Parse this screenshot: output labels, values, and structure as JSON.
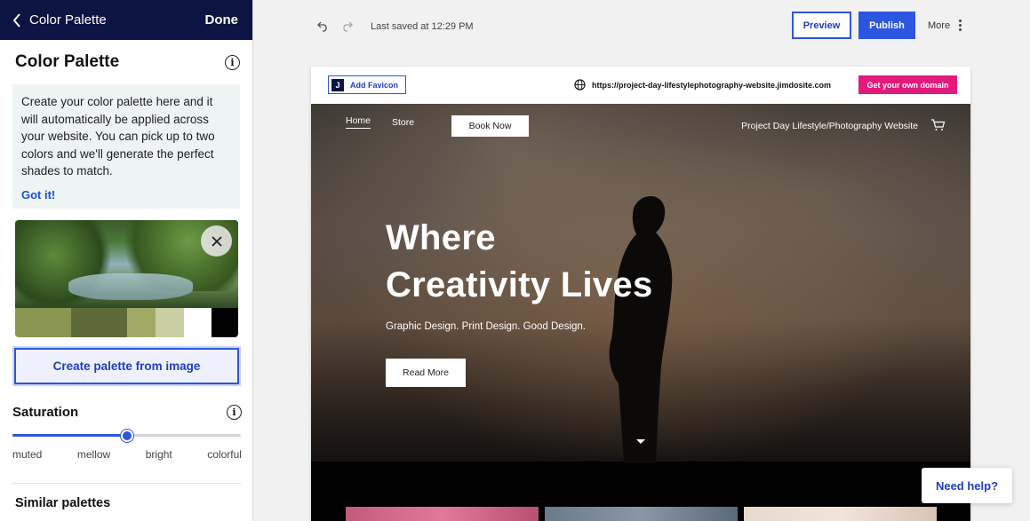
{
  "panel": {
    "back_label": "Color Palette",
    "done_label": "Done",
    "title": "Color Palette",
    "tip_text": "Create your color palette here and it will automatically be applied across your website. You can pick up to two colors and we'll generate the perfect shades to match.",
    "got_it_label": "Got it!",
    "swatches": [
      "#8b9652",
      "#5f6a3a",
      "#a3aa67",
      "#c9cfa2",
      "#ffffff",
      "#000000"
    ],
    "create_button_label": "Create palette from image",
    "saturation": {
      "title": "Saturation",
      "labels": [
        "muted",
        "mellow",
        "bright",
        "colorful"
      ],
      "value_fraction": 0.5
    },
    "similar_title": "Similar palettes"
  },
  "toolbar": {
    "last_saved": "Last saved at 12:29 PM",
    "preview_label": "Preview",
    "publish_label": "Publish",
    "more_label": "More"
  },
  "site": {
    "favicon_label": "Add Favicon",
    "favicon_letter": "J",
    "url": "https://project-day-lifestylephotography-website.jimdosite.com",
    "domain_button": "Get your own domain",
    "nav": {
      "home": "Home",
      "store": "Store",
      "book_now": "Book Now",
      "site_name": "Project Day Lifestyle/Photography Website"
    },
    "headline_line1": "Where",
    "headline_line2": "Creativity Lives",
    "subheadline": "Graphic Design. Print Design. Good Design.",
    "read_more": "Read More"
  },
  "help_label": "Need help?",
  "colors": {
    "accent": "#2e55e0",
    "header_bg": "#0b1443",
    "domain_pink": "#e21a7c"
  }
}
